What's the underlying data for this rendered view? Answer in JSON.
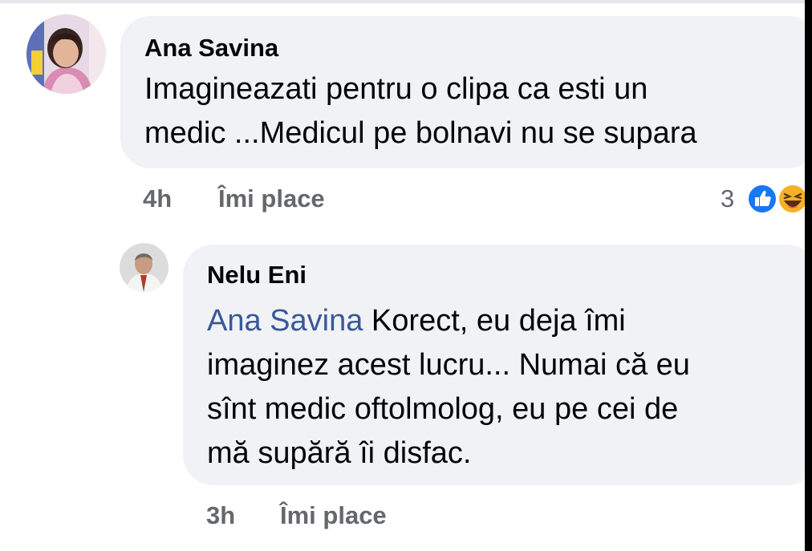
{
  "comments": [
    {
      "author": "Ana Savina",
      "text_lines": [
        "Imagineazati pentru o clipa ca esti un",
        "medic ...Medicul pe bolnavi nu se supara"
      ],
      "time": "4h",
      "like_label": "Îmi place",
      "reaction_count": "3",
      "reactions": [
        "like-icon",
        "haha-icon"
      ],
      "avatar_icon": "user-photo-icon"
    }
  ],
  "reply": {
    "author": "Nelu Eni",
    "mention": "Ana Savina",
    "text_lines": [
      " Korect, eu deja îmi",
      "imaginez acest lucru... Numai că eu",
      "sînt medic oftolmolog, eu pe cei de",
      "mă supără îi disfac."
    ],
    "time": "3h",
    "like_label": "Îmi place",
    "avatar_icon": "user-photo-icon"
  },
  "colors": {
    "bubble_bg": "#f0f2f5",
    "text": "#050505",
    "meta_text": "#65676b",
    "mention": "#385898",
    "like_blue": "#1877f2",
    "haha_yellow": "#f7b125"
  }
}
